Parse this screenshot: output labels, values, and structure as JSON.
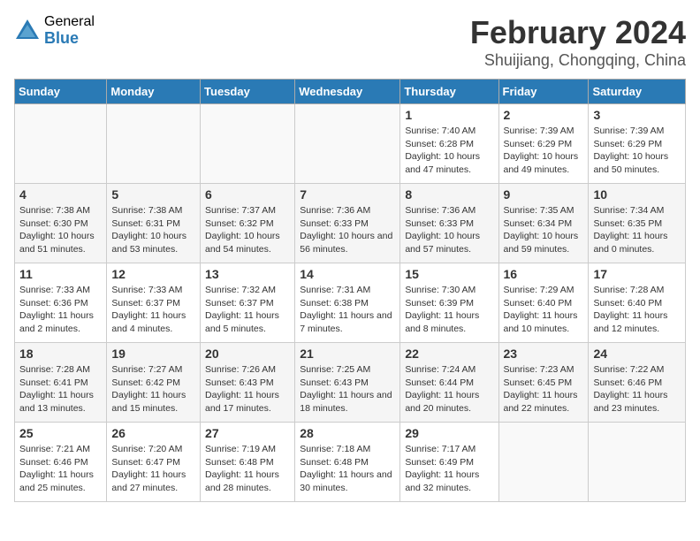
{
  "header": {
    "logo_general": "General",
    "logo_blue": "Blue",
    "title": "February 2024",
    "subtitle": "Shuijiang, Chongqing, China"
  },
  "weekdays": [
    "Sunday",
    "Monday",
    "Tuesday",
    "Wednesday",
    "Thursday",
    "Friday",
    "Saturday"
  ],
  "weeks": [
    [
      {
        "day": "",
        "sunrise": "",
        "sunset": "",
        "daylight": ""
      },
      {
        "day": "",
        "sunrise": "",
        "sunset": "",
        "daylight": ""
      },
      {
        "day": "",
        "sunrise": "",
        "sunset": "",
        "daylight": ""
      },
      {
        "day": "",
        "sunrise": "",
        "sunset": "",
        "daylight": ""
      },
      {
        "day": "1",
        "sunrise": "Sunrise: 7:40 AM",
        "sunset": "Sunset: 6:28 PM",
        "daylight": "Daylight: 10 hours and 47 minutes."
      },
      {
        "day": "2",
        "sunrise": "Sunrise: 7:39 AM",
        "sunset": "Sunset: 6:29 PM",
        "daylight": "Daylight: 10 hours and 49 minutes."
      },
      {
        "day": "3",
        "sunrise": "Sunrise: 7:39 AM",
        "sunset": "Sunset: 6:29 PM",
        "daylight": "Daylight: 10 hours and 50 minutes."
      }
    ],
    [
      {
        "day": "4",
        "sunrise": "Sunrise: 7:38 AM",
        "sunset": "Sunset: 6:30 PM",
        "daylight": "Daylight: 10 hours and 51 minutes."
      },
      {
        "day": "5",
        "sunrise": "Sunrise: 7:38 AM",
        "sunset": "Sunset: 6:31 PM",
        "daylight": "Daylight: 10 hours and 53 minutes."
      },
      {
        "day": "6",
        "sunrise": "Sunrise: 7:37 AM",
        "sunset": "Sunset: 6:32 PM",
        "daylight": "Daylight: 10 hours and 54 minutes."
      },
      {
        "day": "7",
        "sunrise": "Sunrise: 7:36 AM",
        "sunset": "Sunset: 6:33 PM",
        "daylight": "Daylight: 10 hours and 56 minutes."
      },
      {
        "day": "8",
        "sunrise": "Sunrise: 7:36 AM",
        "sunset": "Sunset: 6:33 PM",
        "daylight": "Daylight: 10 hours and 57 minutes."
      },
      {
        "day": "9",
        "sunrise": "Sunrise: 7:35 AM",
        "sunset": "Sunset: 6:34 PM",
        "daylight": "Daylight: 10 hours and 59 minutes."
      },
      {
        "day": "10",
        "sunrise": "Sunrise: 7:34 AM",
        "sunset": "Sunset: 6:35 PM",
        "daylight": "Daylight: 11 hours and 0 minutes."
      }
    ],
    [
      {
        "day": "11",
        "sunrise": "Sunrise: 7:33 AM",
        "sunset": "Sunset: 6:36 PM",
        "daylight": "Daylight: 11 hours and 2 minutes."
      },
      {
        "day": "12",
        "sunrise": "Sunrise: 7:33 AM",
        "sunset": "Sunset: 6:37 PM",
        "daylight": "Daylight: 11 hours and 4 minutes."
      },
      {
        "day": "13",
        "sunrise": "Sunrise: 7:32 AM",
        "sunset": "Sunset: 6:37 PM",
        "daylight": "Daylight: 11 hours and 5 minutes."
      },
      {
        "day": "14",
        "sunrise": "Sunrise: 7:31 AM",
        "sunset": "Sunset: 6:38 PM",
        "daylight": "Daylight: 11 hours and 7 minutes."
      },
      {
        "day": "15",
        "sunrise": "Sunrise: 7:30 AM",
        "sunset": "Sunset: 6:39 PM",
        "daylight": "Daylight: 11 hours and 8 minutes."
      },
      {
        "day": "16",
        "sunrise": "Sunrise: 7:29 AM",
        "sunset": "Sunset: 6:40 PM",
        "daylight": "Daylight: 11 hours and 10 minutes."
      },
      {
        "day": "17",
        "sunrise": "Sunrise: 7:28 AM",
        "sunset": "Sunset: 6:40 PM",
        "daylight": "Daylight: 11 hours and 12 minutes."
      }
    ],
    [
      {
        "day": "18",
        "sunrise": "Sunrise: 7:28 AM",
        "sunset": "Sunset: 6:41 PM",
        "daylight": "Daylight: 11 hours and 13 minutes."
      },
      {
        "day": "19",
        "sunrise": "Sunrise: 7:27 AM",
        "sunset": "Sunset: 6:42 PM",
        "daylight": "Daylight: 11 hours and 15 minutes."
      },
      {
        "day": "20",
        "sunrise": "Sunrise: 7:26 AM",
        "sunset": "Sunset: 6:43 PM",
        "daylight": "Daylight: 11 hours and 17 minutes."
      },
      {
        "day": "21",
        "sunrise": "Sunrise: 7:25 AM",
        "sunset": "Sunset: 6:43 PM",
        "daylight": "Daylight: 11 hours and 18 minutes."
      },
      {
        "day": "22",
        "sunrise": "Sunrise: 7:24 AM",
        "sunset": "Sunset: 6:44 PM",
        "daylight": "Daylight: 11 hours and 20 minutes."
      },
      {
        "day": "23",
        "sunrise": "Sunrise: 7:23 AM",
        "sunset": "Sunset: 6:45 PM",
        "daylight": "Daylight: 11 hours and 22 minutes."
      },
      {
        "day": "24",
        "sunrise": "Sunrise: 7:22 AM",
        "sunset": "Sunset: 6:46 PM",
        "daylight": "Daylight: 11 hours and 23 minutes."
      }
    ],
    [
      {
        "day": "25",
        "sunrise": "Sunrise: 7:21 AM",
        "sunset": "Sunset: 6:46 PM",
        "daylight": "Daylight: 11 hours and 25 minutes."
      },
      {
        "day": "26",
        "sunrise": "Sunrise: 7:20 AM",
        "sunset": "Sunset: 6:47 PM",
        "daylight": "Daylight: 11 hours and 27 minutes."
      },
      {
        "day": "27",
        "sunrise": "Sunrise: 7:19 AM",
        "sunset": "Sunset: 6:48 PM",
        "daylight": "Daylight: 11 hours and 28 minutes."
      },
      {
        "day": "28",
        "sunrise": "Sunrise: 7:18 AM",
        "sunset": "Sunset: 6:48 PM",
        "daylight": "Daylight: 11 hours and 30 minutes."
      },
      {
        "day": "29",
        "sunrise": "Sunrise: 7:17 AM",
        "sunset": "Sunset: 6:49 PM",
        "daylight": "Daylight: 11 hours and 32 minutes."
      },
      {
        "day": "",
        "sunrise": "",
        "sunset": "",
        "daylight": ""
      },
      {
        "day": "",
        "sunrise": "",
        "sunset": "",
        "daylight": ""
      }
    ]
  ]
}
